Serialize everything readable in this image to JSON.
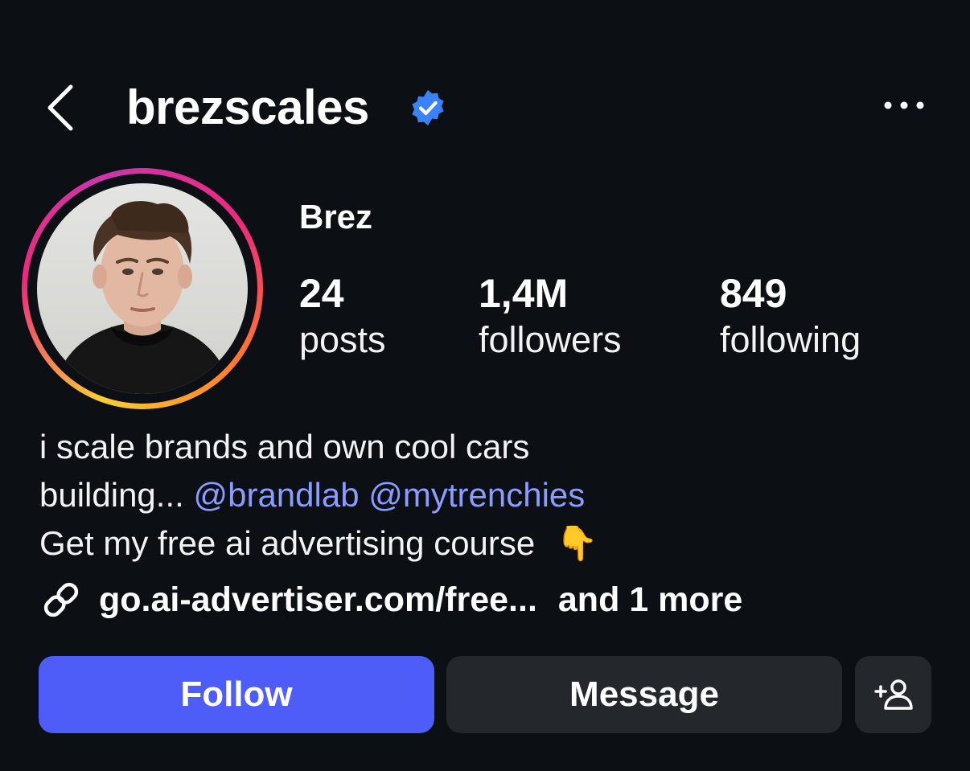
{
  "header": {
    "back_icon": "chevron-left-icon",
    "username": "brezscales",
    "verified_icon": "verified-badge-icon",
    "verified_color": "#3b82f6",
    "more_icon": "ellipsis-icon"
  },
  "profile": {
    "display_name": "Brez",
    "stats": [
      {
        "value": "24",
        "label": "posts"
      },
      {
        "value": "1,4M",
        "label": "followers"
      },
      {
        "value": "849",
        "label": "following"
      }
    ]
  },
  "bio": {
    "line1": "i scale brands and own cool cars",
    "line2_prefix": "building... ",
    "mention1": "@brandlab",
    "mention2": "@mytrenchies",
    "line3": "Get my free ai advertising course",
    "line3_emoji": "👇",
    "mention_color": "#8b9cff"
  },
  "link": {
    "icon": "link-icon",
    "url": "go.ai-advertiser.com/free...",
    "more": "and 1 more"
  },
  "actions": {
    "follow_label": "Follow",
    "message_label": "Message",
    "add_user_icon": "add-person-icon",
    "follow_color": "#4f5df8"
  }
}
